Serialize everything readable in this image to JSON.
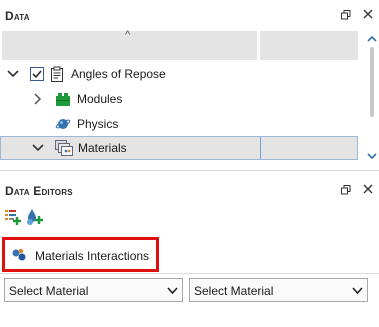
{
  "data_panel": {
    "title": "Data",
    "sort_indicator": "^",
    "tree": {
      "root": {
        "label": "Angles of Repose",
        "checked": true,
        "expanded": true
      },
      "children": [
        {
          "label": "Modules",
          "expanded": false,
          "icon": "modules-icon"
        },
        {
          "label": "Physics",
          "icon": "physics-icon"
        },
        {
          "label": "Materials",
          "expanded": true,
          "selected": true,
          "icon": "materials-icon"
        }
      ]
    }
  },
  "data_editors_panel": {
    "title": "Data Editors",
    "toolbar": {
      "buttons": [
        "add-editor-icon",
        "add-materials-icon"
      ]
    },
    "materials_interactions_button": {
      "label": "Materials Interactions",
      "highlight_color": "#e01010"
    },
    "selects": {
      "first": {
        "selected": "Select Material"
      },
      "second": {
        "selected": "Select Material"
      }
    }
  },
  "colors": {
    "accent": "#3572b0",
    "selection_border": "#7aa0cc",
    "highlight": "#e01010"
  }
}
